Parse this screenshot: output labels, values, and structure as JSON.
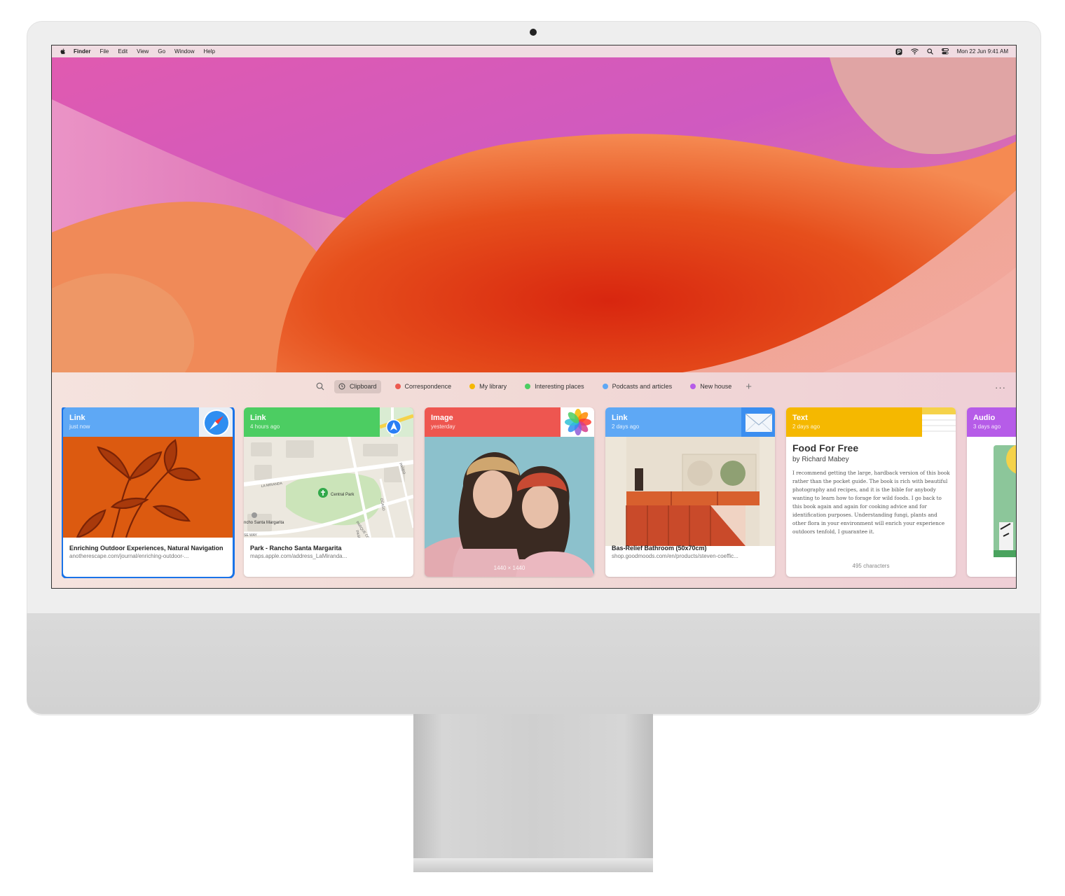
{
  "menubar": {
    "app": "Finder",
    "items": [
      "File",
      "Edit",
      "View",
      "Go",
      "Window",
      "Help"
    ],
    "clock": "Mon 22 Jun  9:41 AM",
    "icons": [
      "paste-icon",
      "wifi-icon",
      "search-icon",
      "control-center-icon"
    ]
  },
  "toolbar": {
    "search_icon": "search-icon",
    "tabs": [
      {
        "label": "Clipboard",
        "color": "",
        "icon": "history-icon"
      },
      {
        "label": "Correspondence",
        "color": "#ec5a50"
      },
      {
        "label": "My library",
        "color": "#f5b800"
      },
      {
        "label": "Interesting places",
        "color": "#4ccd62"
      },
      {
        "label": "Podcasts and articles",
        "color": "#5ea8f5"
      },
      {
        "label": "New house",
        "color": "#b65ce8"
      }
    ],
    "add": "+",
    "more": "···"
  },
  "cards": [
    {
      "type": "Link",
      "time": "just now",
      "color": "#5ea8f5",
      "app": "safari-icon",
      "title": "Enriching Outdoor Experiences, Natural Navigation",
      "url": "anotherescape.com/journal/enriching-outdoor-..."
    },
    {
      "type": "Link",
      "time": "4 hours ago",
      "color": "#4ccd62",
      "app": "maps-icon",
      "title": "Park - Rancho Santa Margarita",
      "url": "maps.apple.com/address_LaMiranda...",
      "map_labels": [
        "Central Park",
        "LA MIRANDA",
        "ncho Santa Margarita",
        "PASEO",
        "OCASO",
        "PARQUE CORTE",
        "PASEO",
        "SE WAY"
      ]
    },
    {
      "type": "Image",
      "time": "yesterday",
      "color": "#ee5650",
      "app": "photos-icon",
      "dimensions": "1440 × 1440"
    },
    {
      "type": "Link",
      "time": "2 days ago",
      "color": "#5ea8f5",
      "app": "mail-icon",
      "title": "Bas-Relief Bathroom (50x70cm)",
      "url": "shop.goodmoods.com/en/products/steven-coeffic..."
    },
    {
      "type": "Text",
      "time": "2 days ago",
      "color": "#f5b800",
      "app": "notes-icon",
      "title": "Food For Free",
      "author": "by Richard Mabey",
      "body": "I recommend getting the large, hardback version of this book rather than the pocket guide. The book is rich with beautiful photography and recipes, and it is the bible for anybody wanting to learn how to forage for wild foods. I go back to this book again and again for cooking advice and for identification purposes. Understanding fungi, plants and other flora in your environment will enrich your experience outdoors tenfold, I guarantee it.",
      "count": "495 characters"
    },
    {
      "type": "Audio",
      "time": "3 days ago",
      "color": "#b65ce8"
    }
  ]
}
